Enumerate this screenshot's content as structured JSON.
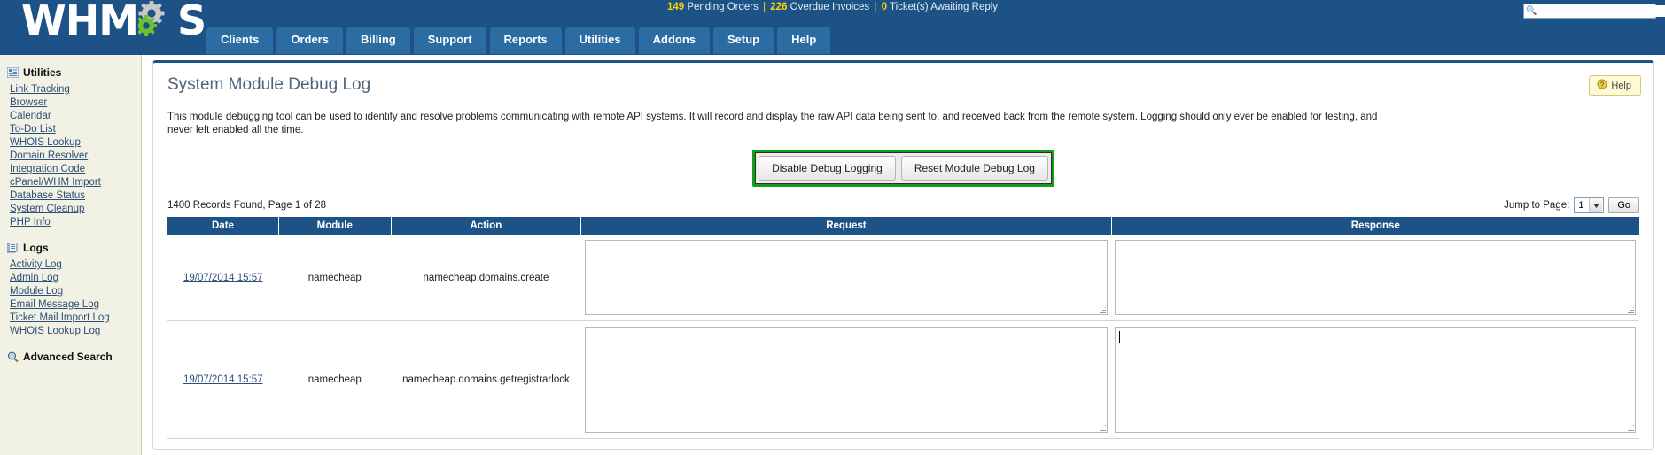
{
  "header": {
    "logo_text_left": "WHM",
    "logo_text_right": "S",
    "status": {
      "pending_count": "149",
      "pending_label": "Pending Orders",
      "overdue_count": "226",
      "overdue_label": "Overdue Invoices",
      "tickets_count": "0",
      "tickets_label": "Ticket(s) Awaiting Reply",
      "separator": "|"
    },
    "search": {
      "placeholder": "",
      "value": "",
      "icon": "search-icon"
    },
    "nav_tabs": [
      {
        "label": "Clients"
      },
      {
        "label": "Orders"
      },
      {
        "label": "Billing"
      },
      {
        "label": "Support"
      },
      {
        "label": "Reports"
      },
      {
        "label": "Utilities"
      },
      {
        "label": "Addons"
      },
      {
        "label": "Setup"
      },
      {
        "label": "Help"
      }
    ]
  },
  "sidebar": {
    "sections": [
      {
        "title": "Utilities",
        "icon": "utilities-icon",
        "items": [
          {
            "label": "Link Tracking"
          },
          {
            "label": "Browser"
          },
          {
            "label": "Calendar"
          },
          {
            "label": "To-Do List"
          },
          {
            "label": "WHOIS Lookup"
          },
          {
            "label": "Domain Resolver"
          },
          {
            "label": "Integration Code"
          },
          {
            "label": "cPanel/WHM Import"
          },
          {
            "label": "Database Status"
          },
          {
            "label": "System Cleanup"
          },
          {
            "label": "PHP Info"
          }
        ]
      },
      {
        "title": "Logs",
        "icon": "logs-icon",
        "items": [
          {
            "label": "Activity Log"
          },
          {
            "label": "Admin Log"
          },
          {
            "label": "Module Log"
          },
          {
            "label": "Email Message Log"
          },
          {
            "label": "Ticket Mail Import Log"
          },
          {
            "label": "WHOIS Lookup Log"
          }
        ]
      },
      {
        "title": "Advanced Search",
        "icon": "magnifier-icon",
        "items": []
      }
    ]
  },
  "main": {
    "page_title": "System Module Debug Log",
    "help_label": "Help",
    "help_icon": "help-icon",
    "description": "This module debugging tool can be used to identify and resolve problems communicating with remote API systems. It will record and display the raw API data being sent to, and received back from the remote system. Logging should only ever be enabled for testing, and never left enabled all the time.",
    "buttons": {
      "disable_logging": "Disable Debug Logging",
      "reset_log": "Reset Module Debug Log",
      "highlight_color": "#14a014"
    },
    "records_text": "1400 Records Found, Page 1 of 28",
    "pagination": {
      "jump_label": "Jump to Page:",
      "current_page": "1",
      "go_label": "Go"
    },
    "table": {
      "columns": [
        "Date",
        "Module",
        "Action",
        "Request",
        "Response"
      ],
      "rows": [
        {
          "date": "19/07/2014 15:57",
          "module": "namecheap",
          "action": "namecheap.domains.create",
          "request": "",
          "response": ""
        },
        {
          "date": "19/07/2014 15:57",
          "module": "namecheap",
          "action": "namecheap.domains.getregistrarlock",
          "request": "",
          "response": ""
        }
      ]
    }
  }
}
